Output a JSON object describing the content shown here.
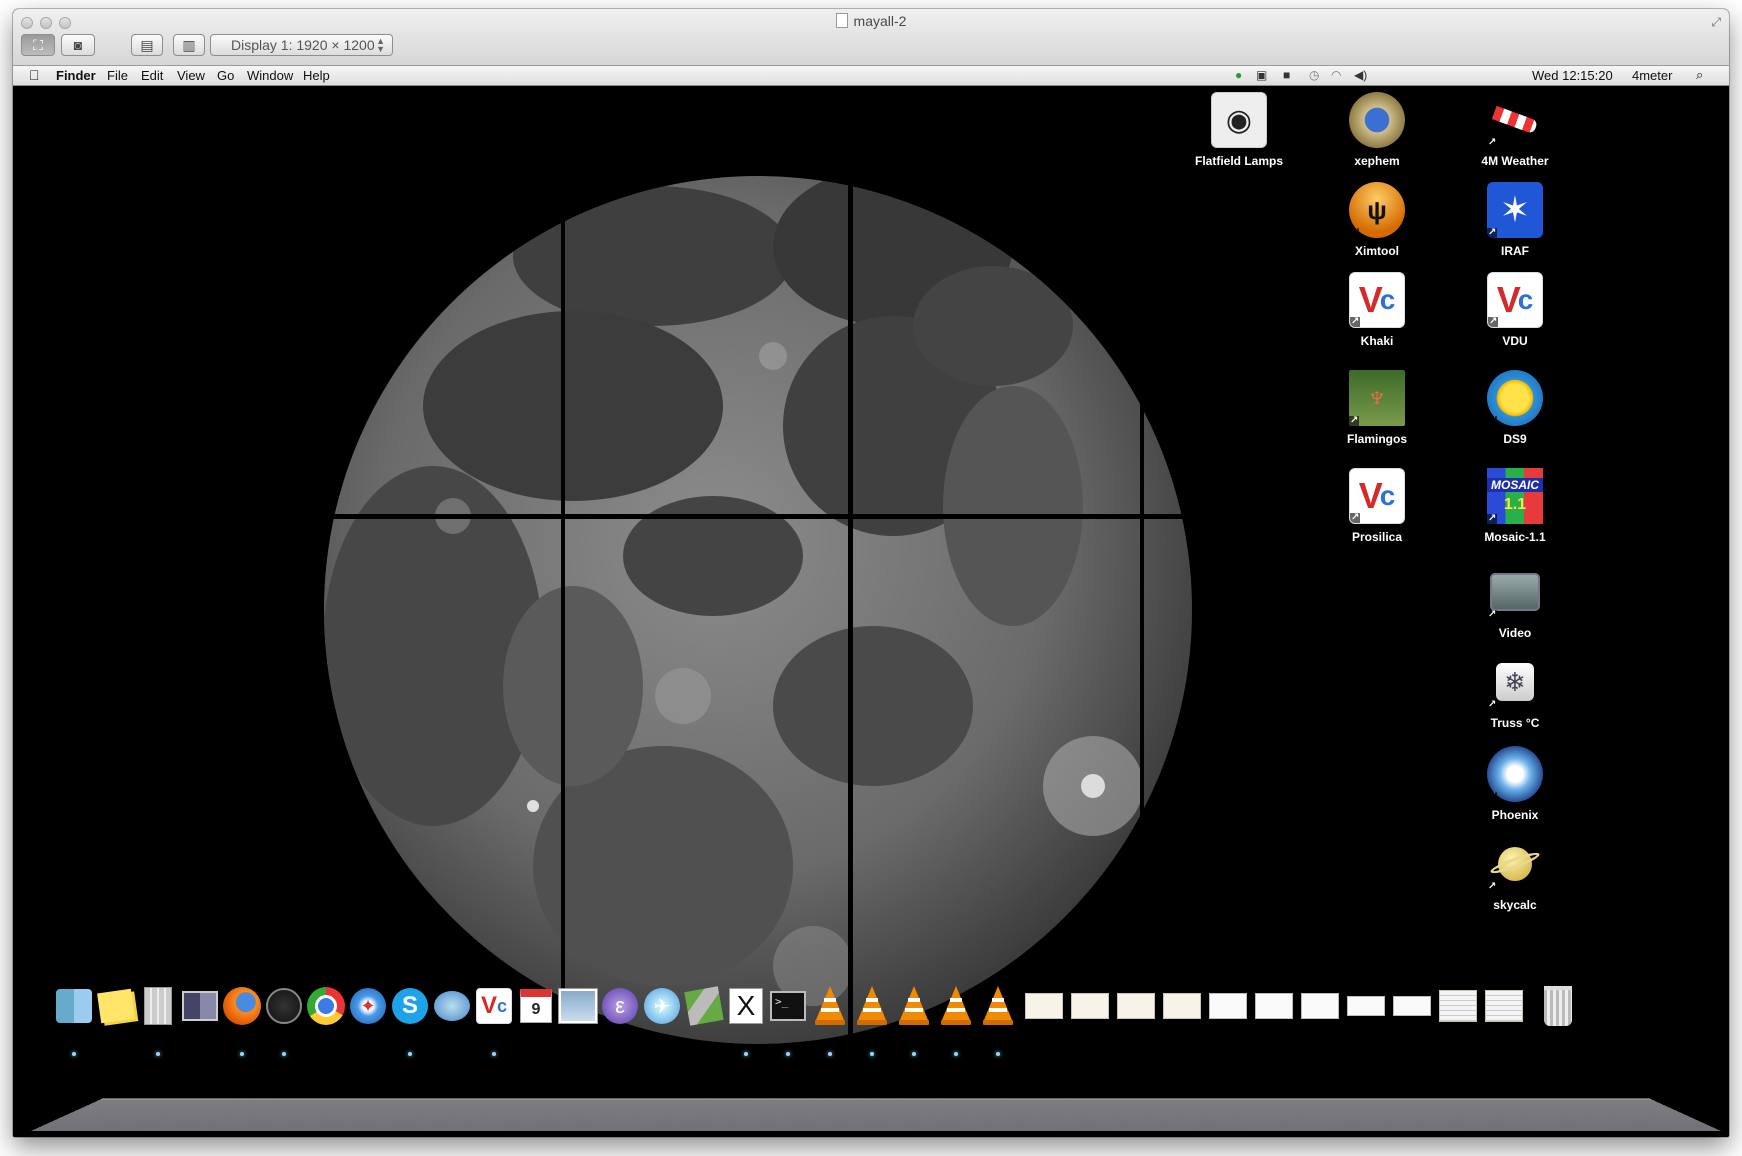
{
  "window": {
    "title": "mayall-2",
    "display_select": "Display 1: 1920 × 1200"
  },
  "menubar": {
    "app_name": "Finder",
    "items": [
      "File",
      "Edit",
      "View",
      "Go",
      "Window",
      "Help"
    ],
    "clock": "Wed 12:15:20",
    "user": "4meter"
  },
  "desktop_icons": [
    {
      "label": "Flatfield Lamps",
      "icon": "spotlight-lamp-icon"
    },
    {
      "label": "xephem",
      "icon": "xephem-icon"
    },
    {
      "label": "4M Weather",
      "icon": "windsock-icon"
    },
    {
      "label": "Ximtool",
      "icon": "ximtool-icon"
    },
    {
      "label": "IRAF",
      "icon": "iraf-icon"
    },
    {
      "label": "Khaki",
      "icon": "vnc-icon"
    },
    {
      "label": "VDU",
      "icon": "vnc-icon"
    },
    {
      "label": "Flamingos",
      "icon": "flamingos-icon"
    },
    {
      "label": "DS9",
      "icon": "ds9-icon"
    },
    {
      "label": "Prosilica",
      "icon": "vnc-icon"
    },
    {
      "label": "Mosaic-1.1",
      "icon": "mosaic-icon",
      "icon_text": "MOSAIC",
      "icon_subtext": "1.1"
    },
    {
      "label": "Video",
      "icon": "tv-icon"
    },
    {
      "label": "Truss °C",
      "icon": "snowflake-icon"
    },
    {
      "label": "Phoenix",
      "icon": "phoenix-icon"
    },
    {
      "label": "skycalc",
      "icon": "saturn-icon"
    }
  ],
  "dock": {
    "calendar_day": "9",
    "x11_glyph": "X",
    "terminal_prompt": ">_"
  }
}
